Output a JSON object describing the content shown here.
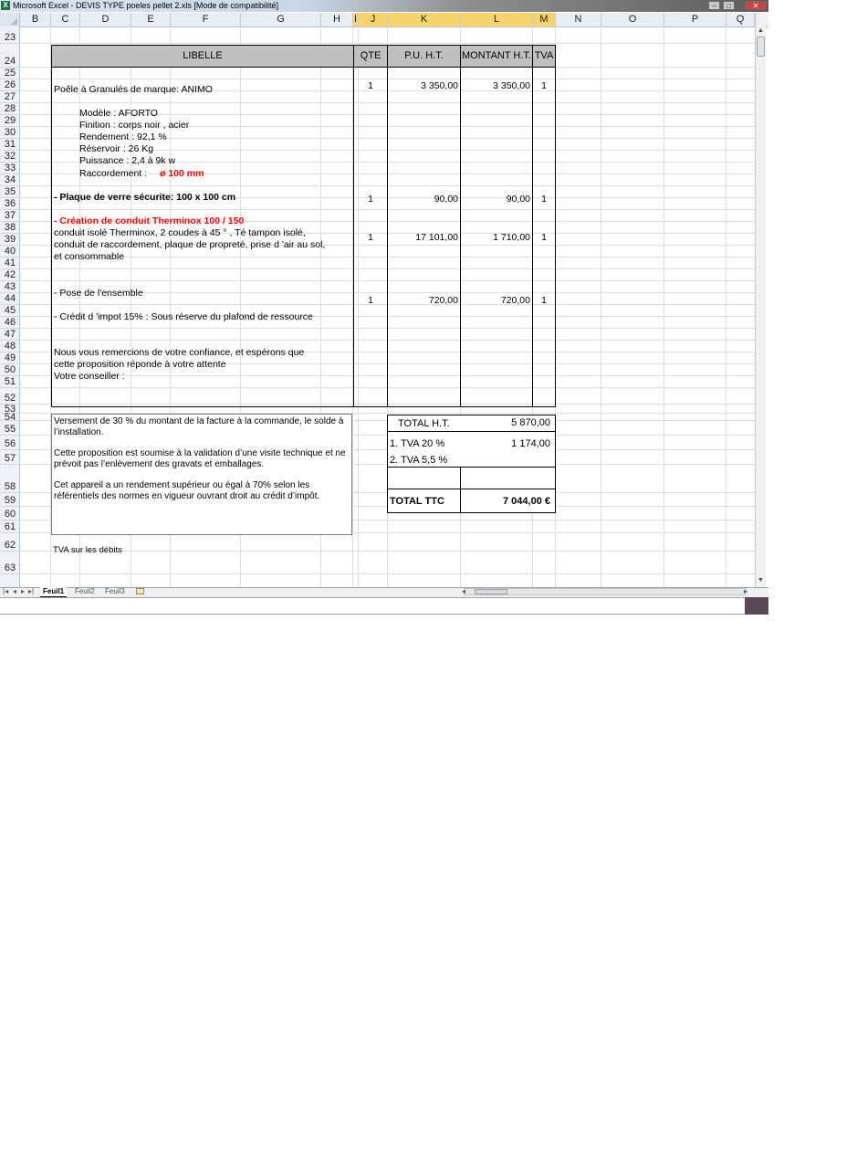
{
  "window": {
    "title": "Microsoft Excel - DEVIS TYPE poeles pellet 2.xls  [Mode de compatibilité]",
    "app_icon": "X",
    "minimize": "–",
    "maximize": "□",
    "close": "✕"
  },
  "columns": [
    "B",
    "C",
    "D",
    "E",
    "F",
    "G",
    "H",
    "I",
    "J",
    "K",
    "L",
    "M",
    "N",
    "O",
    "P",
    "Q"
  ],
  "rows": [
    "23",
    "24",
    "25",
    "26",
    "27",
    "28",
    "29",
    "30",
    "31",
    "32",
    "33",
    "34",
    "35",
    "36",
    "37",
    "38",
    "39",
    "40",
    "41",
    "42",
    "43",
    "44",
    "45",
    "46",
    "47",
    "48",
    "49",
    "50",
    "51",
    "52",
    "53",
    "54",
    "55",
    "56",
    "57",
    "58",
    "59",
    "60",
    "61",
    "62",
    "63"
  ],
  "table": {
    "headers": {
      "libelle": "LIBELLE",
      "qte": "QTE",
      "pu": "P.U. H.T.",
      "montant": "MONTANT H.T.",
      "tva": "TVA"
    },
    "lines": {
      "poele": "Poêle  à  Granulés   de  marque:  ANIMO",
      "modele": "Modèle  : AFORTO",
      "finition": "Finition   : corps noir   , acier",
      "rendement": "Rendement  : 92,1  %",
      "reservoir": "Réservoir   :   26  Kg",
      "puissance": "Puissance  :  2,4 à 9k w",
      "raccordement_label": "Raccordement  :",
      "raccordement_value": "ø  100  mm",
      "plaque": "- Plaque  de  verre  sécurite:   100  x  100  cm",
      "creation": "- Création  de  conduit  Therminox  100  / 150",
      "conduit1": " conduit  isolé  Therminox,  2  coudes  à  45 ° ,  Té  tampon  isolé,",
      "conduit2": "conduit  de  raccordement,   plaque  de  propreté,  prise d 'air au sol,",
      "conduit3": "et  consommable",
      "pose": "- Pose  de  l'ensemble",
      "credit": "- Crédit  d 'impot  15% :  Sous  réserve  du  plafond  de  ressource",
      "merci1": "Nous  vous  remercions  de  votre  confiance,  et  espérons  que",
      "merci2": "cette  proposition  réponde  à votre  attente",
      "merci3": "Votre  conseiller  :"
    },
    "items": [
      {
        "qte": "1",
        "pu": "3 350,00",
        "montant": "3 350,00",
        "tva": "1"
      },
      {
        "qte": "1",
        "pu": "90,00",
        "montant": "90,00",
        "tva": "1"
      },
      {
        "qte": "1",
        "pu": "17 101,00",
        "montant": "1 710,00",
        "tva": "1"
      },
      {
        "qte": "1",
        "pu": "720,00",
        "montant": "720,00",
        "tva": "1"
      }
    ]
  },
  "notes": {
    "versement1": "Versement de 30 % du montant de la facture à la commande, le solde à",
    "versement2": "l’installation.",
    "validation1": "Cette proposition est soumise à la validation d’une visite technique et ne",
    "validation2": "prévoit pas l’enlèvement des gravats et emballages.",
    "appareil1": "Cet appareil a un rendement supérieur ou égal à 70% selon les",
    "appareil2": "référentiels des normes en vigueur ouvrant droit au crédit d’impôt.",
    "tva_debits": "TVA sur les débits"
  },
  "totals": {
    "total_ht_label": "TOTAL H.T.",
    "total_ht": "5 870,00",
    "tva20_label": "1. TVA 20 %",
    "tva20": "1 174,00",
    "tva55_label": "2. TVA 5,5 %",
    "ttc_label": "TOTAL TTC",
    "ttc": "7 044,00 €"
  },
  "sheets": [
    "Feuil1",
    "Feuil2",
    "Feuil3"
  ],
  "icons": {
    "nav_first": "|◂",
    "nav_prev": "◂",
    "nav_next": "▸",
    "nav_last": "▸|",
    "scroll_up": "▲",
    "scroll_down": "▼",
    "scroll_left": "◂",
    "scroll_right": "▸"
  },
  "colors": {
    "selected_header": "#f6d36b",
    "grid": "#dadfe6",
    "header_fill": "#c0c0c0",
    "emphasis_red": "#ff0000"
  }
}
